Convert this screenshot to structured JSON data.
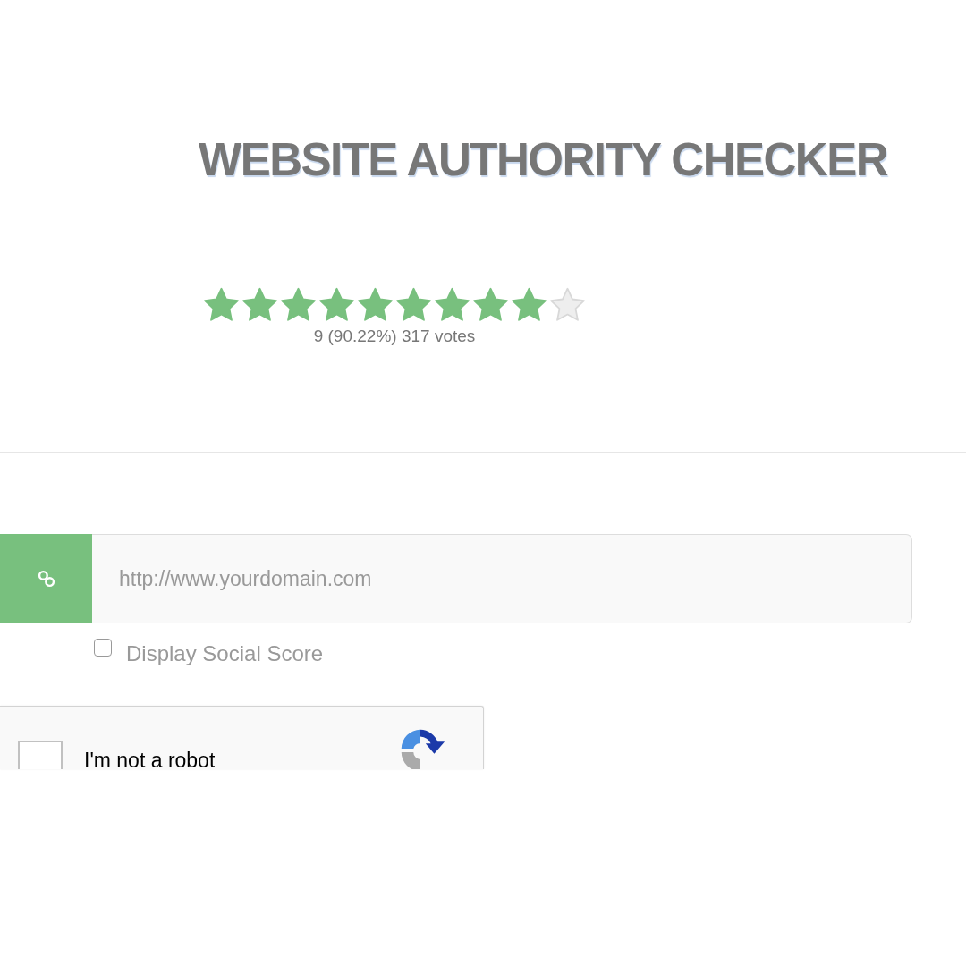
{
  "title": "WEBSITE AUTHORITY CHECKER",
  "rating": {
    "stars": 9,
    "summary": "9 (90.22%) 317 votes"
  },
  "url_field": {
    "placeholder": "http://www.yourdomain.com"
  },
  "social_score": {
    "label": "Display Social Score",
    "checked": false
  },
  "captcha": {
    "label": "I'm not a robot",
    "checked": false
  }
}
